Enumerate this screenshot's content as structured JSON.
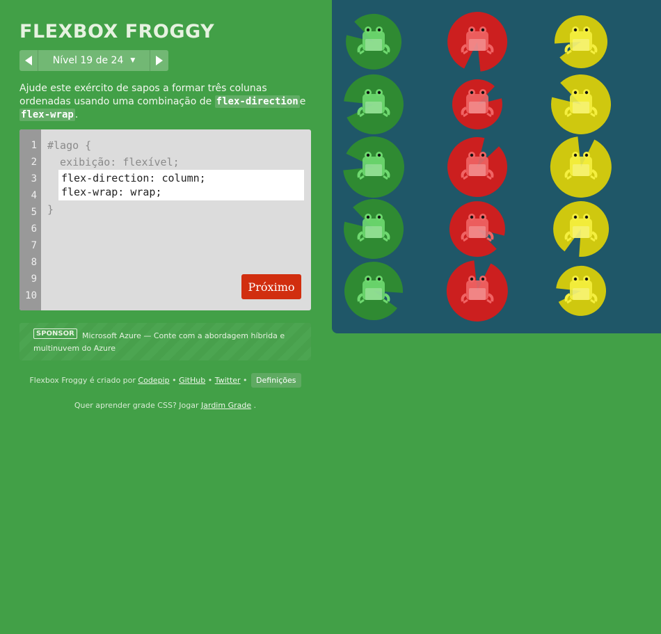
{
  "title": "FLEXBOX FROGGY",
  "level": {
    "label": "Nível 19 de 24"
  },
  "instructions": {
    "before": "Ajude este exército de sapos a formar três colunas ordenadas usando uma combinação de ",
    "code1": "flex-direction",
    "middle": "e ",
    "code2": "flex-wrap",
    "after": "."
  },
  "editor": {
    "line_numbers": [
      "1",
      "2",
      "3",
      "4",
      "5",
      "6",
      "7",
      "8",
      "9",
      "10"
    ],
    "line1": "#lago {",
    "line2": "  exibição: flexível;",
    "input_line1": "flex-direction: column;",
    "input_line2": "flex-wrap: wrap;",
    "line5": "}",
    "next_button": "Próximo"
  },
  "sponsor": {
    "badge": "SPONSOR",
    "text": "Microsoft Azure — Conte com a abordagem híbrida e multinuvem do Azure"
  },
  "credits": {
    "prefix": "Flexbox Froggy é criado por ",
    "link_codepip": "Codepip",
    "sep1": " • ",
    "link_github": "GitHub",
    "sep2": " • ",
    "link_twitter": "Twitter",
    "sep3": " • ",
    "settings": "Definições"
  },
  "grid_promo": {
    "prefix": "Quer aprender grade CSS? Jogar ",
    "link": "Jardim Grade",
    "suffix": " ."
  },
  "colors": {
    "green_pad": "#2f8a32",
    "green_frog": "#6fd970",
    "red_pad": "#cc1f1f",
    "red_frog": "#f06464",
    "yellow_pad": "#cfc80f",
    "yellow_frog": "#f5ef3f"
  },
  "pond": {
    "columns": [
      "green",
      "red",
      "yellow"
    ],
    "frogs_per_column": 5
  }
}
